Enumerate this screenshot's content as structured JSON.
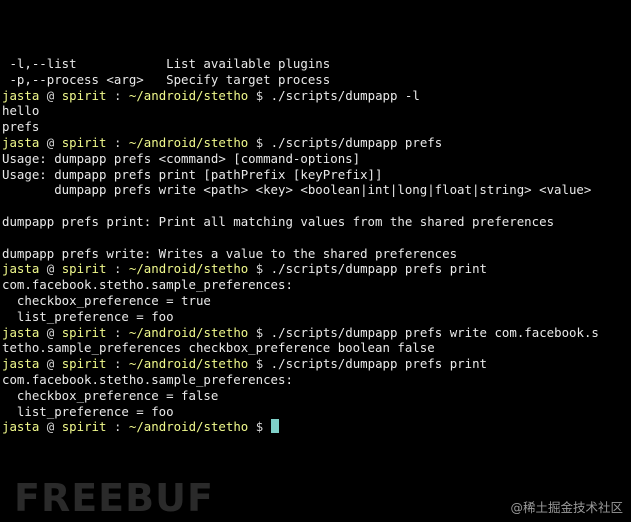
{
  "colors": {
    "background": "#000000",
    "output_text": "#eaeaea",
    "prompt_highlight": "#f1fa8c",
    "cursor": "#7fd0c8"
  },
  "terminal": {
    "lines": [
      {
        "type": "output",
        "text": " -l,--list            List available plugins"
      },
      {
        "type": "output",
        "text": " -p,--process <arg>   Specify target process"
      },
      {
        "type": "prompt",
        "user": "jasta",
        "at": "@",
        "host": "spirit",
        "sep": ":",
        "path": "~/android/stetho",
        "symbol": "$",
        "command": "./scripts/dumpapp -l"
      },
      {
        "type": "output",
        "text": "hello"
      },
      {
        "type": "output",
        "text": "prefs"
      },
      {
        "type": "prompt",
        "user": "jasta",
        "at": "@",
        "host": "spirit",
        "sep": ":",
        "path": "~/android/stetho",
        "symbol": "$",
        "command": "./scripts/dumpapp prefs"
      },
      {
        "type": "output",
        "text": "Usage: dumpapp prefs <command> [command-options]"
      },
      {
        "type": "output",
        "text": "Usage: dumpapp prefs print [pathPrefix [keyPrefix]]"
      },
      {
        "type": "output",
        "text": "       dumpapp prefs write <path> <key> <boolean|int|long|float|string> <value>"
      },
      {
        "type": "output",
        "text": ""
      },
      {
        "type": "output",
        "text": "dumpapp prefs print: Print all matching values from the shared preferences"
      },
      {
        "type": "output",
        "text": ""
      },
      {
        "type": "output",
        "text": "dumpapp prefs write: Writes a value to the shared preferences"
      },
      {
        "type": "prompt",
        "user": "jasta",
        "at": "@",
        "host": "spirit",
        "sep": ":",
        "path": "~/android/stetho",
        "symbol": "$",
        "command": "./scripts/dumpapp prefs print"
      },
      {
        "type": "output",
        "text": "com.facebook.stetho.sample_preferences:"
      },
      {
        "type": "output",
        "text": "  checkbox_preference = true"
      },
      {
        "type": "output",
        "text": "  list_preference = foo"
      },
      {
        "type": "prompt",
        "user": "jasta",
        "at": "@",
        "host": "spirit",
        "sep": ":",
        "path": "~/android/stetho",
        "symbol": "$",
        "command": "./scripts/dumpapp prefs write com.facebook.s"
      },
      {
        "type": "output",
        "text": "tetho.sample_preferences checkbox_preference boolean false"
      },
      {
        "type": "prompt",
        "user": "jasta",
        "at": "@",
        "host": "spirit",
        "sep": ":",
        "path": "~/android/stetho",
        "symbol": "$",
        "command": "./scripts/dumpapp prefs print"
      },
      {
        "type": "output",
        "text": "com.facebook.stetho.sample_preferences:"
      },
      {
        "type": "output",
        "text": "  checkbox_preference = false"
      },
      {
        "type": "output",
        "text": "  list_preference = foo"
      },
      {
        "type": "prompt",
        "user": "jasta",
        "at": "@",
        "host": "spirit",
        "sep": ":",
        "path": "~/android/stetho",
        "symbol": "$",
        "command": "",
        "cursor": true
      }
    ]
  },
  "watermarks": {
    "freebuf": "FREEBUF",
    "juejin": "@稀土掘金技术社区"
  }
}
